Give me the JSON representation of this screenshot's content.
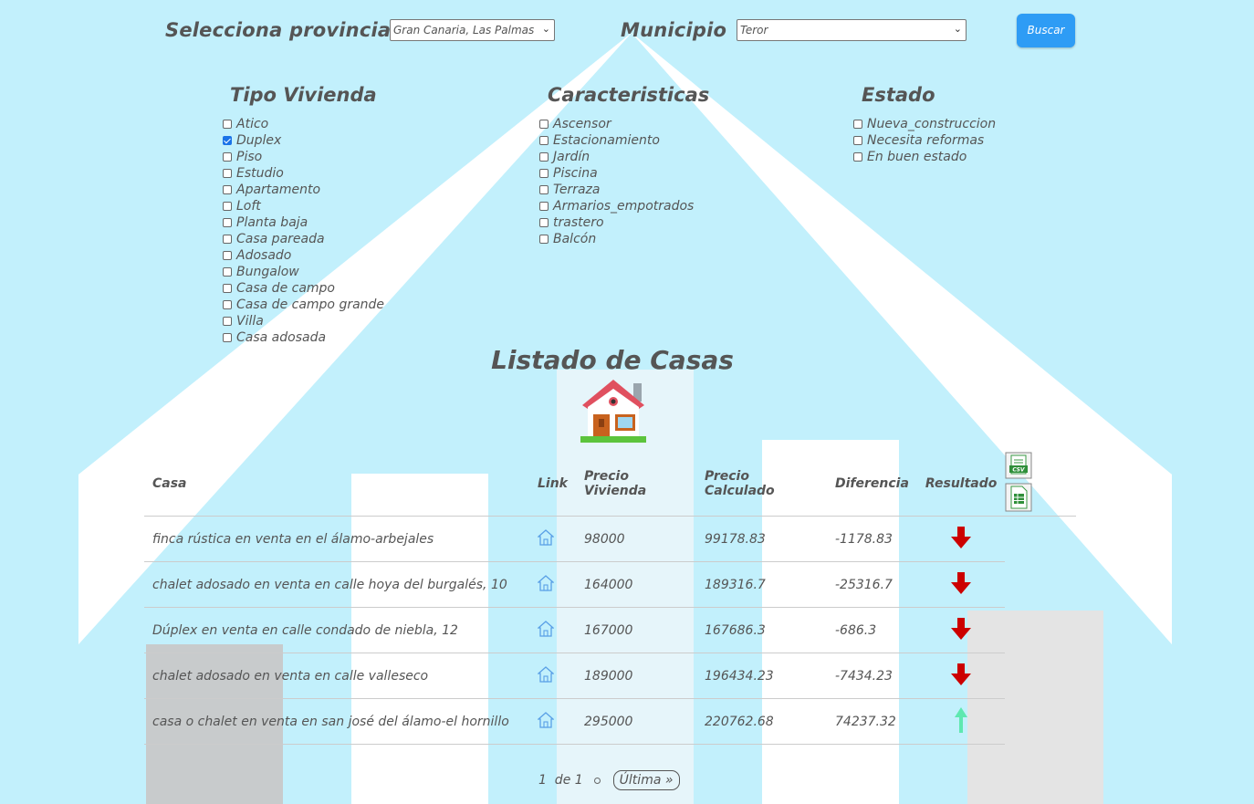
{
  "search": {
    "province_label": "Selecciona provincia",
    "province_value": "Gran Canaria, Las Palmas",
    "municipio_label": "Municipio",
    "municipio_value": "Teror",
    "buscar_label": "Buscar"
  },
  "filters": {
    "tipo": {
      "title": "Tipo Vivienda",
      "items": [
        {
          "label": "Atico",
          "checked": false
        },
        {
          "label": "Duplex",
          "checked": true
        },
        {
          "label": "Piso",
          "checked": false
        },
        {
          "label": "Estudio",
          "checked": false
        },
        {
          "label": "Apartamento",
          "checked": false
        },
        {
          "label": "Loft",
          "checked": false
        },
        {
          "label": "Planta baja",
          "checked": false
        },
        {
          "label": "Casa pareada",
          "checked": false
        },
        {
          "label": "Adosado",
          "checked": false
        },
        {
          "label": "Bungalow",
          "checked": false
        },
        {
          "label": "Casa de campo",
          "checked": false
        },
        {
          "label": "Casa de campo grande",
          "checked": false
        },
        {
          "label": "Villa",
          "checked": false
        },
        {
          "label": "Casa adosada",
          "checked": false
        }
      ]
    },
    "caracteristicas": {
      "title": "Caracteristicas",
      "items": [
        {
          "label": "Ascensor",
          "checked": false
        },
        {
          "label": "Estacionamiento",
          "checked": false
        },
        {
          "label": "Jardín",
          "checked": false
        },
        {
          "label": "Piscina",
          "checked": false
        },
        {
          "label": "Terraza",
          "checked": false
        },
        {
          "label": "Armarios_empotrados",
          "checked": false
        },
        {
          "label": "trastero",
          "checked": false
        },
        {
          "label": "Balcón",
          "checked": false
        }
      ]
    },
    "estado": {
      "title": "Estado",
      "items": [
        {
          "label": "Nueva_construccion",
          "checked": false
        },
        {
          "label": "Necesita reformas",
          "checked": false
        },
        {
          "label": "En buen estado",
          "checked": false
        }
      ]
    }
  },
  "listing": {
    "title": "Listado de Casas",
    "icon": "house-icon",
    "columns": [
      "Casa",
      "Link",
      "Precio Vivienda",
      "Precio Calculado",
      "Diferencia",
      "Resultado"
    ],
    "export_icons": [
      "csv-export-icon",
      "spreadsheet-export-icon"
    ],
    "rows": [
      {
        "casa": "finca rústica en venta en el álamo-arbejales",
        "precio": "98000",
        "calculado": "99178.83",
        "diferencia": "-1178.83",
        "resultado": "down"
      },
      {
        "casa": "chalet adosado en venta en calle hoya del burgalés, 10",
        "precio": "164000",
        "calculado": "189316.7",
        "diferencia": "-25316.7",
        "resultado": "down"
      },
      {
        "casa": "Dúplex en venta en calle condado de niebla, 12",
        "precio": "167000",
        "calculado": "167686.3",
        "diferencia": "-686.3",
        "resultado": "down"
      },
      {
        "casa": "chalet adosado en venta en calle valleseco",
        "precio": "189000",
        "calculado": "196434.23",
        "diferencia": "-7434.23",
        "resultado": "down"
      },
      {
        "casa": "casa o chalet en venta en san josé del álamo-el hornillo",
        "precio": "295000",
        "calculado": "220762.68",
        "diferencia": "74237.32",
        "resultado": "up"
      }
    ]
  },
  "pagination": {
    "page_info": "1  de 1",
    "last_label": "Última »"
  },
  "colors": {
    "background": "#c2f0fc",
    "button": "#2e9cf5",
    "arrow_down": "#cc0000",
    "arrow_up": "#5ee8b0"
  }
}
